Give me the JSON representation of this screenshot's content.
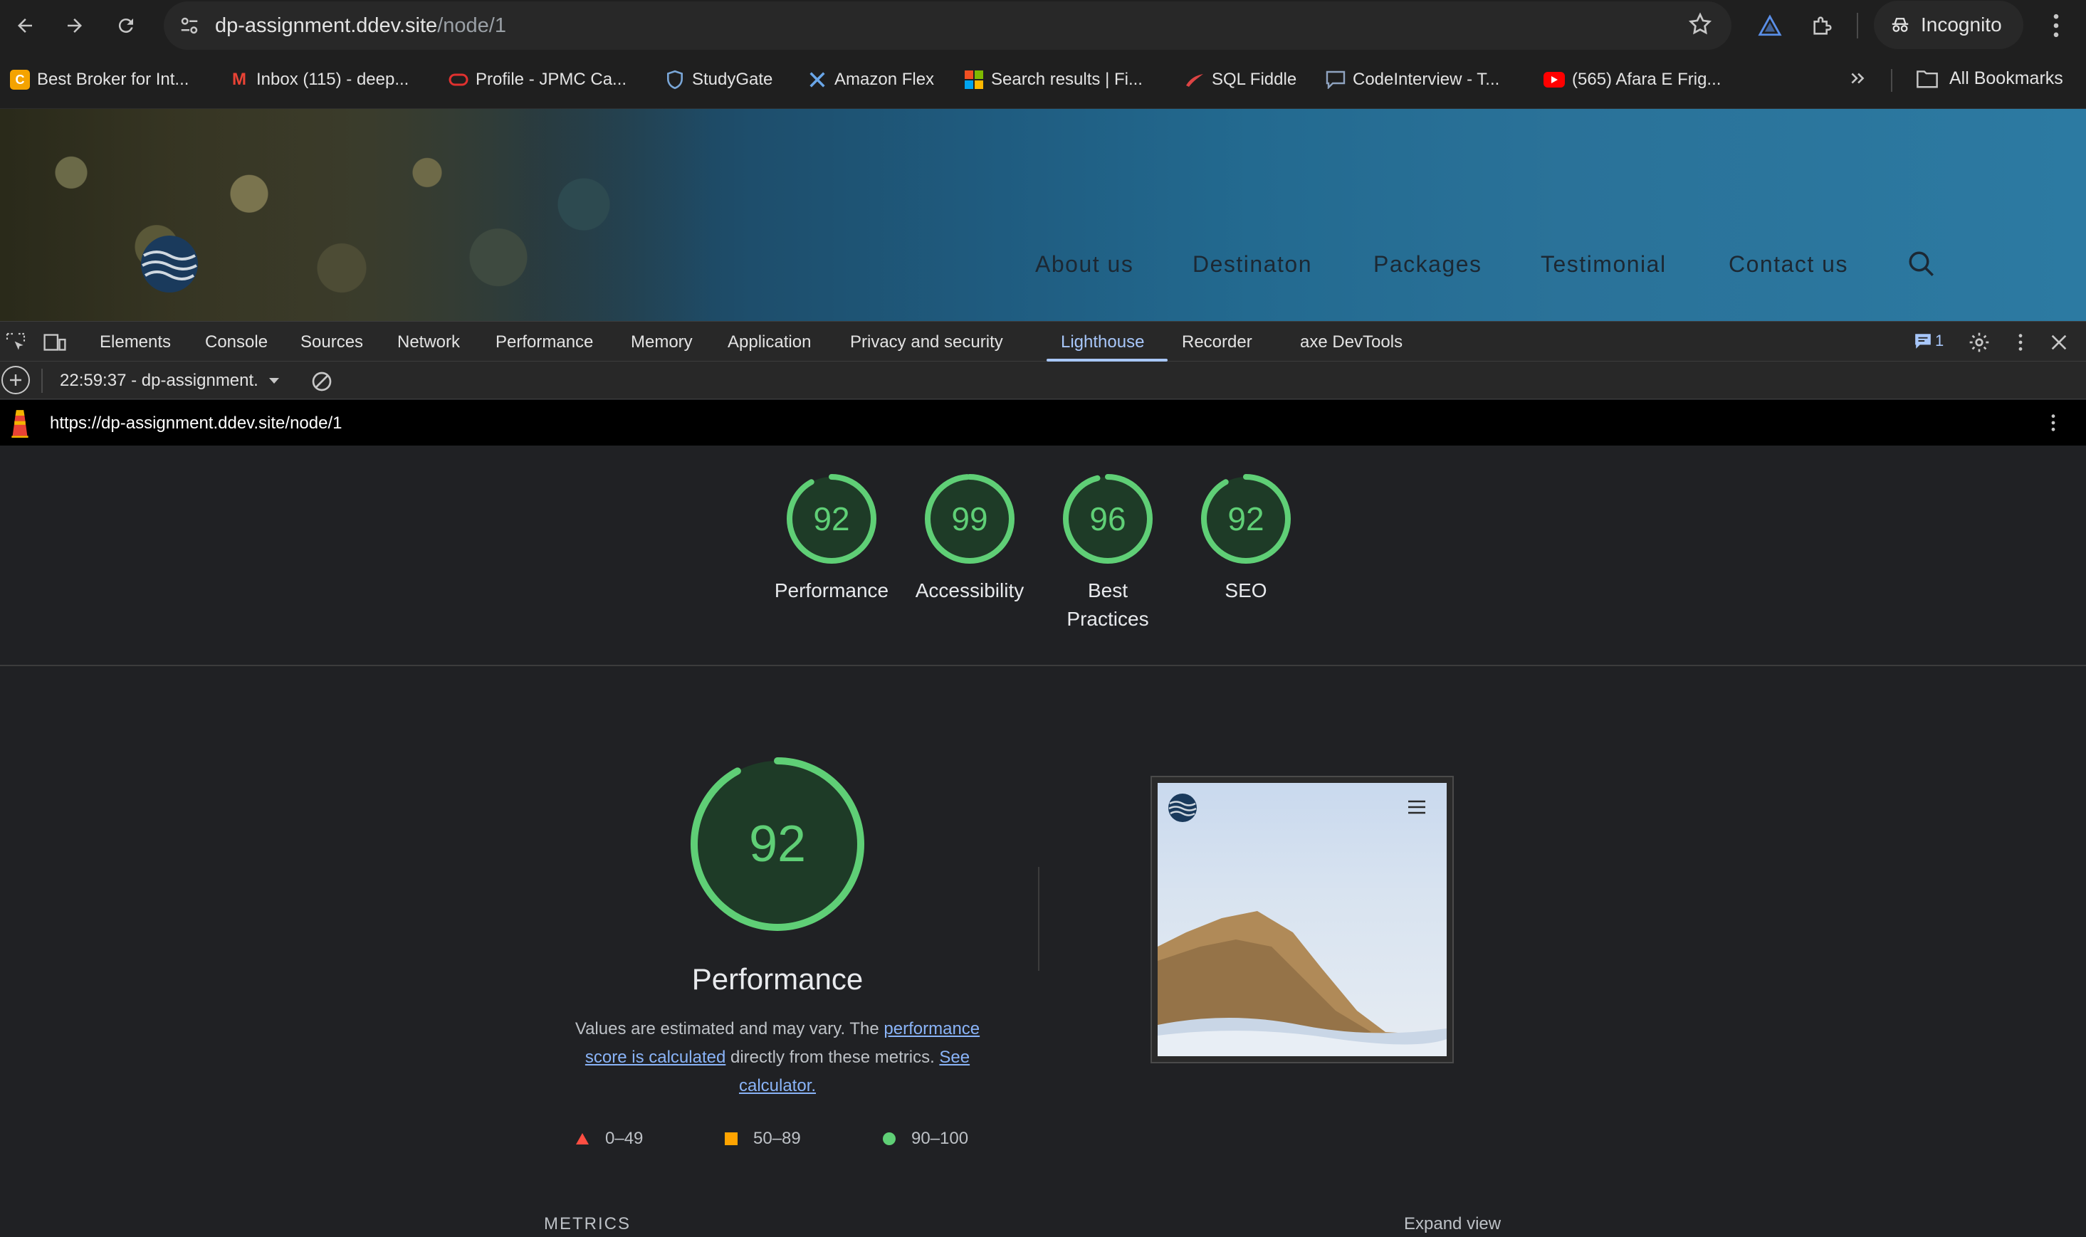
{
  "browser": {
    "url_host": "dp-assignment.ddev.site",
    "url_path": "/node/1",
    "incognito_label": "Incognito"
  },
  "bookmarks": {
    "items": [
      {
        "label": "Best Broker for Int...",
        "icon": "broker-icon",
        "color": "#f4a300"
      },
      {
        "label": "Inbox (115) - deep...",
        "icon": "gmail-icon",
        "color": "#ea4335"
      },
      {
        "label": "Profile - JPMC Ca...",
        "icon": "oracle-icon",
        "color": "#e0312f"
      },
      {
        "label": "StudyGate",
        "icon": "shield-icon",
        "color": "#7aa7d8"
      },
      {
        "label": "Amazon Flex",
        "icon": "flex-icon",
        "color": "#6aa6e8"
      },
      {
        "label": "Search results | Fi...",
        "icon": "microsoft-icon",
        "color": "#f25022"
      },
      {
        "label": "SQL Fiddle",
        "icon": "sqlfiddle-icon",
        "color": "#d44"
      },
      {
        "label": "CodeInterview - T...",
        "icon": "chat-icon",
        "color": "#8fa3c0"
      },
      {
        "label": "(565) Afara E Frig...",
        "icon": "youtube-icon",
        "color": "#ff0000"
      }
    ],
    "all_bookmarks_label": "All Bookmarks"
  },
  "site": {
    "nav": [
      "About us",
      "Destinaton",
      "Packages",
      "Testimonial",
      "Contact us"
    ]
  },
  "devtools": {
    "tabs": [
      "Elements",
      "Console",
      "Sources",
      "Network",
      "Performance",
      "Memory",
      "Application",
      "Privacy and security",
      "Lighthouse",
      "Recorder",
      "axe DevTools"
    ],
    "active_tab": "Lighthouse",
    "message_count": "1",
    "report_select": "22:59:37 - dp-assignment.",
    "lighthouse_url": "https://dp-assignment.ddev.site/node/1"
  },
  "report": {
    "scores": [
      {
        "value": 92,
        "label": "Performance"
      },
      {
        "value": 99,
        "label": "Accessibility"
      },
      {
        "value": 96,
        "label": "Best Practices"
      },
      {
        "value": 92,
        "label": "SEO"
      }
    ],
    "performance": {
      "score": 92,
      "title": "Performance",
      "desc_prefix": "Values are estimated and may vary. The ",
      "desc_link1": "performance score is calculated",
      "desc_middle": " directly from these metrics. ",
      "desc_link2": "See calculator."
    },
    "legend": [
      {
        "range": "0–49",
        "color": "#ff4e42",
        "shape": "triangle"
      },
      {
        "range": "50–89",
        "color": "#ffa400",
        "shape": "square"
      },
      {
        "range": "90–100",
        "color": "#5fcf76",
        "shape": "circle"
      }
    ],
    "metrics_label": "METRICS",
    "expand_label": "Expand view",
    "colors": {
      "pass": "#5fcf76",
      "ring_bg": "#1e3b27"
    }
  }
}
